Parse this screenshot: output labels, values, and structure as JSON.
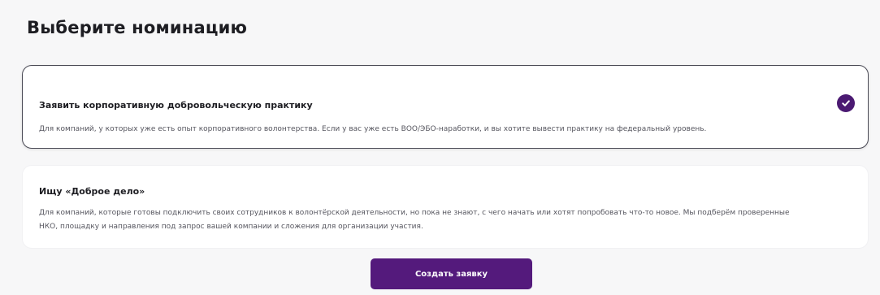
{
  "header": {
    "title": "Выберите номинацию"
  },
  "nominations": [
    {
      "title": "Заявить корпоративную добровольческую практику",
      "description": "Для компаний, у которых уже есть опыт корпоративного волонтерства. Если у вас уже есть ВОО/ЭБО-наработки, и вы хотите вывести практику на федеральный уровень.",
      "selected": true,
      "check_icon": "check-circle-icon"
    },
    {
      "title": "Ищу «Доброе дело»",
      "description": "Для компаний, которые готовы подключить своих сотрудников к волонтёрской деятельности, но пока не знают, с чего начать или хотят попробовать что-то новое. Мы подберём проверенные НКО, площадку и направления под запрос вашей компании и сложения для организации участия.",
      "selected": false
    }
  ],
  "actions": {
    "submit_label": "Создать заявку"
  },
  "colors": {
    "accent": "#541a7c",
    "check": "#4b1a72",
    "background": "#f7f7f8",
    "card": "#ffffff"
  }
}
